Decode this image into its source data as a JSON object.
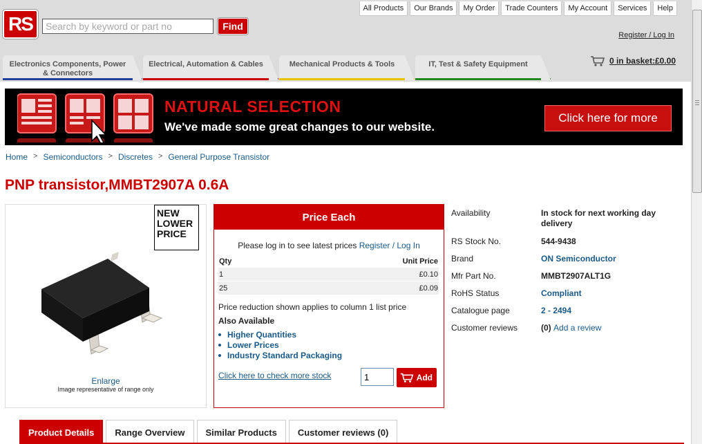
{
  "header": {
    "logo_text": "RS",
    "search_placeholder": "Search by keyword or part no",
    "find_label": "Find",
    "top_nav": [
      "All Products",
      "Our Brands",
      "My Order",
      "Trade Counters",
      "My Account",
      "Services",
      "Help"
    ],
    "register_login": "Register / Log In",
    "basket": "0 in basket:£0.00",
    "categories": [
      {
        "line1": "Electronics Components, Power",
        "line2": "& Connectors",
        "color": "#1f3f9a"
      },
      {
        "line1": "Electrical, Automation & Cables",
        "line2": "",
        "color": "#cc0000"
      },
      {
        "line1": "Mechanical Products & Tools",
        "line2": "",
        "color": "#e6c400"
      },
      {
        "line1": "IT, Test & Safety Equipment",
        "line2": "",
        "color": "#228822"
      }
    ]
  },
  "banner": {
    "title": "NATURAL SELECTION",
    "subtitle": "We've made some great changes to our website.",
    "button": "Click here for more"
  },
  "breadcrumb": [
    "Home",
    "Semiconductors",
    "Discretes",
    "General Purpose Transistor"
  ],
  "breadcrumb_sep": ">",
  "product": {
    "title": "PNP transistor,MMBT2907A 0.6A",
    "badge_lines": [
      "NEW",
      "LOWER",
      "PRICE"
    ],
    "enlarge": "Enlarge",
    "image_note": "Image representative of range only"
  },
  "pricing": {
    "header": "Price Each",
    "login_prompt": "Please log in to see latest prices",
    "login_link": "Register / Log In",
    "col_qty": "Qty",
    "col_unit": "Unit Price",
    "rows": [
      {
        "qty": "1",
        "price": "£0.10"
      },
      {
        "qty": "25",
        "price": "£0.09"
      }
    ],
    "reduction_note": "Price reduction shown applies to column 1 list price",
    "also_available": "Also Available",
    "also_items": [
      "Higher Quantities",
      "Lower Prices",
      "Industry Standard Packaging"
    ],
    "check_stock": "Click here to check more stock",
    "qty_value": "1",
    "add_label": "Add"
  },
  "details": {
    "availability_label": "Availability",
    "availability_value": "In stock for next working day delivery",
    "stock_label": "RS Stock No.",
    "stock_value": "544-9438",
    "brand_label": "Brand",
    "brand_value": "ON Semiconductor",
    "mfr_label": "Mfr Part No.",
    "mfr_value": "MMBT2907ALT1G",
    "rohs_label": "RoHS Status",
    "rohs_value": "Compliant",
    "catalogue_label": "Catalogue page",
    "catalogue_value": "2 - 2494",
    "reviews_label": "Customer reviews",
    "reviews_count": "(0)",
    "reviews_link": "Add a review"
  },
  "tabs": [
    "Product Details",
    "Range Overview",
    "Similar Products",
    "Customer reviews (0)"
  ]
}
